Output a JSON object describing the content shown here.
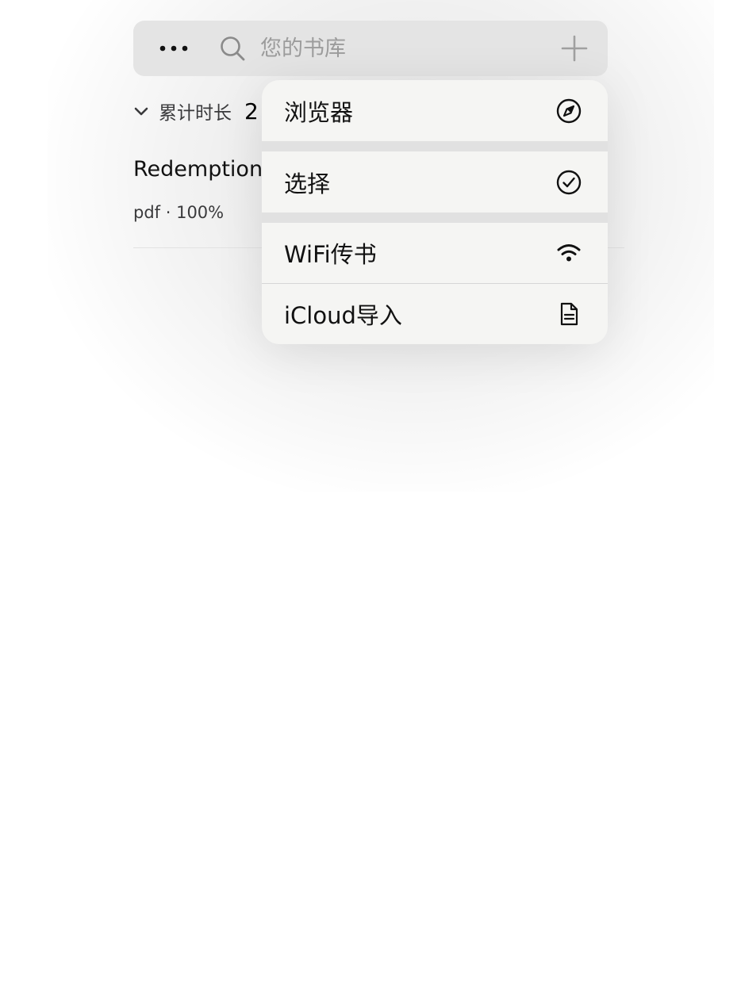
{
  "search": {
    "placeholder": "您的书库",
    "more_icon": "more-horizontal-icon",
    "search_icon": "magnifier-icon",
    "add_icon": "plus-icon"
  },
  "stats": {
    "label": "累计时长",
    "value": "2"
  },
  "books": [
    {
      "title": "Redemption",
      "meta": "pdf · 100%"
    }
  ],
  "menu": {
    "items": [
      {
        "label": "浏览器",
        "icon": "compass-icon"
      },
      {
        "label": "选择",
        "icon": "checkmark-circle-icon"
      },
      {
        "label": "WiFi传书",
        "icon": "wifi-icon"
      },
      {
        "label": "iCloud导入",
        "icon": "document-icon"
      }
    ]
  },
  "colors": {
    "search_bg": "#e4e4e4",
    "menu_bg": "#f5f5f3",
    "separator": "#e1e1e1",
    "placeholder": "#9c9c9c"
  }
}
